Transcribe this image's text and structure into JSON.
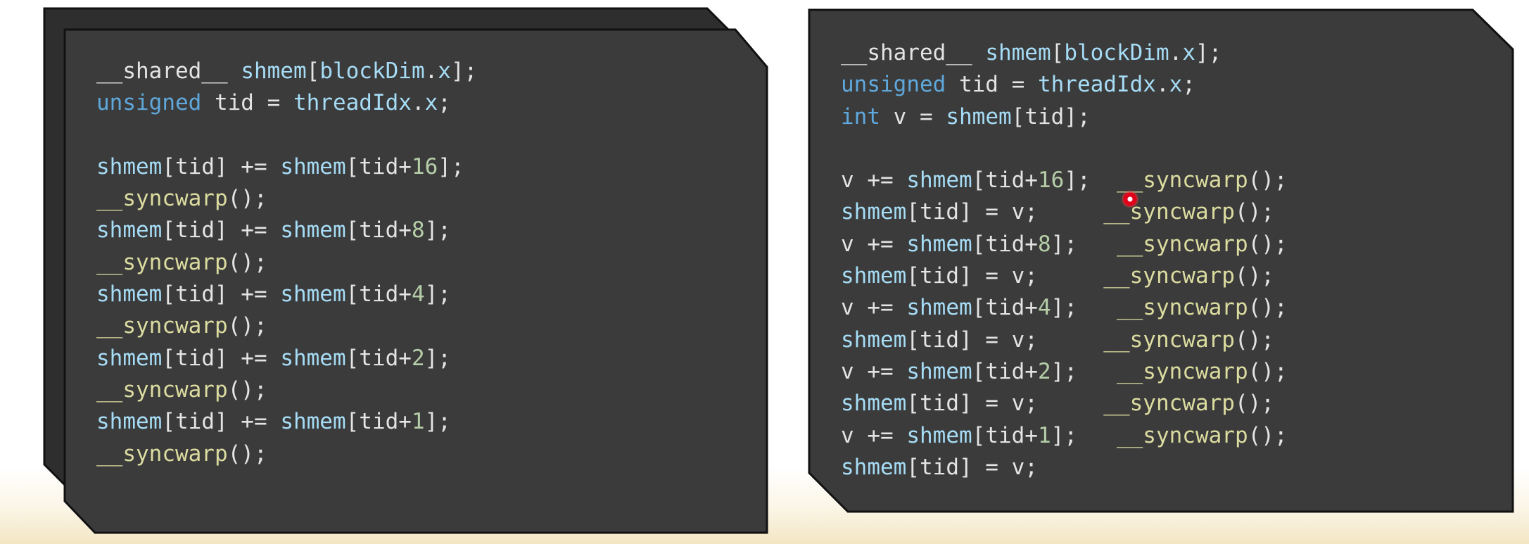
{
  "colors": {
    "panel_bg": "#3b3b3b",
    "keyword": "#5fa8dc",
    "identifier": "#a6dcf5",
    "function": "#dcdca0",
    "number": "#b5cea8",
    "plain": "#e4e4e4"
  },
  "left_panel": {
    "lines": [
      [
        {
          "t": "__shared__ ",
          "c": "pl"
        },
        {
          "t": "shmem",
          "c": "id"
        },
        {
          "t": "[",
          "c": "pl"
        },
        {
          "t": "blockDim",
          "c": "id"
        },
        {
          "t": ".",
          "c": "pl"
        },
        {
          "t": "x",
          "c": "id"
        },
        {
          "t": "];",
          "c": "pl"
        }
      ],
      [
        {
          "t": "unsigned",
          "c": "kw"
        },
        {
          "t": " tid = ",
          "c": "pl"
        },
        {
          "t": "threadIdx",
          "c": "id"
        },
        {
          "t": ".",
          "c": "pl"
        },
        {
          "t": "x",
          "c": "id"
        },
        {
          "t": ";",
          "c": "pl"
        }
      ],
      [],
      [
        {
          "t": "shmem",
          "c": "id"
        },
        {
          "t": "[tid] += ",
          "c": "pl"
        },
        {
          "t": "shmem",
          "c": "id"
        },
        {
          "t": "[tid+",
          "c": "pl"
        },
        {
          "t": "16",
          "c": "num"
        },
        {
          "t": "];",
          "c": "pl"
        }
      ],
      [
        {
          "t": "__syncwarp",
          "c": "fn"
        },
        {
          "t": "();",
          "c": "pl"
        }
      ],
      [
        {
          "t": "shmem",
          "c": "id"
        },
        {
          "t": "[tid] += ",
          "c": "pl"
        },
        {
          "t": "shmem",
          "c": "id"
        },
        {
          "t": "[tid+",
          "c": "pl"
        },
        {
          "t": "8",
          "c": "num"
        },
        {
          "t": "];",
          "c": "pl"
        }
      ],
      [
        {
          "t": "__syncwarp",
          "c": "fn"
        },
        {
          "t": "();",
          "c": "pl"
        }
      ],
      [
        {
          "t": "shmem",
          "c": "id"
        },
        {
          "t": "[tid] += ",
          "c": "pl"
        },
        {
          "t": "shmem",
          "c": "id"
        },
        {
          "t": "[tid+",
          "c": "pl"
        },
        {
          "t": "4",
          "c": "num"
        },
        {
          "t": "];",
          "c": "pl"
        }
      ],
      [
        {
          "t": "__syncwarp",
          "c": "fn"
        },
        {
          "t": "();",
          "c": "pl"
        }
      ],
      [
        {
          "t": "shmem",
          "c": "id"
        },
        {
          "t": "[tid] += ",
          "c": "pl"
        },
        {
          "t": "shmem",
          "c": "id"
        },
        {
          "t": "[tid+",
          "c": "pl"
        },
        {
          "t": "2",
          "c": "num"
        },
        {
          "t": "];",
          "c": "pl"
        }
      ],
      [
        {
          "t": "__syncwarp",
          "c": "fn"
        },
        {
          "t": "();",
          "c": "pl"
        }
      ],
      [
        {
          "t": "shmem",
          "c": "id"
        },
        {
          "t": "[tid] += ",
          "c": "pl"
        },
        {
          "t": "shmem",
          "c": "id"
        },
        {
          "t": "[tid+",
          "c": "pl"
        },
        {
          "t": "1",
          "c": "num"
        },
        {
          "t": "];",
          "c": "pl"
        }
      ],
      [
        {
          "t": "__syncwarp",
          "c": "fn"
        },
        {
          "t": "();",
          "c": "pl"
        }
      ]
    ]
  },
  "right_panel": {
    "lines": [
      [
        {
          "t": "__shared__ ",
          "c": "pl"
        },
        {
          "t": "shmem",
          "c": "id"
        },
        {
          "t": "[",
          "c": "pl"
        },
        {
          "t": "blockDim",
          "c": "id"
        },
        {
          "t": ".",
          "c": "pl"
        },
        {
          "t": "x",
          "c": "id"
        },
        {
          "t": "];",
          "c": "pl"
        }
      ],
      [
        {
          "t": "unsigned",
          "c": "kw"
        },
        {
          "t": " tid = ",
          "c": "pl"
        },
        {
          "t": "threadIdx",
          "c": "id"
        },
        {
          "t": ".",
          "c": "pl"
        },
        {
          "t": "x",
          "c": "id"
        },
        {
          "t": ";",
          "c": "pl"
        }
      ],
      [
        {
          "t": "int",
          "c": "kw"
        },
        {
          "t": " v = ",
          "c": "pl"
        },
        {
          "t": "shmem",
          "c": "id"
        },
        {
          "t": "[tid];",
          "c": "pl"
        }
      ],
      [],
      [
        {
          "t": "v += ",
          "c": "pl"
        },
        {
          "t": "shmem",
          "c": "id"
        },
        {
          "t": "[tid+",
          "c": "pl"
        },
        {
          "t": "16",
          "c": "num"
        },
        {
          "t": "];  ",
          "c": "pl"
        },
        {
          "t": "__syncwarp",
          "c": "fn"
        },
        {
          "t": "();",
          "c": "pl"
        }
      ],
      [
        {
          "t": "shmem",
          "c": "id"
        },
        {
          "t": "[tid] = v;     ",
          "c": "pl"
        },
        {
          "t": "__syncwarp",
          "c": "fn"
        },
        {
          "t": "();",
          "c": "pl"
        }
      ],
      [
        {
          "t": "v += ",
          "c": "pl"
        },
        {
          "t": "shmem",
          "c": "id"
        },
        {
          "t": "[tid+",
          "c": "pl"
        },
        {
          "t": "8",
          "c": "num"
        },
        {
          "t": "];   ",
          "c": "pl"
        },
        {
          "t": "__syncwarp",
          "c": "fn"
        },
        {
          "t": "();",
          "c": "pl"
        }
      ],
      [
        {
          "t": "shmem",
          "c": "id"
        },
        {
          "t": "[tid] = v;     ",
          "c": "pl"
        },
        {
          "t": "__syncwarp",
          "c": "fn"
        },
        {
          "t": "();",
          "c": "pl"
        }
      ],
      [
        {
          "t": "v += ",
          "c": "pl"
        },
        {
          "t": "shmem",
          "c": "id"
        },
        {
          "t": "[tid+",
          "c": "pl"
        },
        {
          "t": "4",
          "c": "num"
        },
        {
          "t": "];   ",
          "c": "pl"
        },
        {
          "t": "__syncwarp",
          "c": "fn"
        },
        {
          "t": "();",
          "c": "pl"
        }
      ],
      [
        {
          "t": "shmem",
          "c": "id"
        },
        {
          "t": "[tid] = v;     ",
          "c": "pl"
        },
        {
          "t": "__syncwarp",
          "c": "fn"
        },
        {
          "t": "();",
          "c": "pl"
        }
      ],
      [
        {
          "t": "v += ",
          "c": "pl"
        },
        {
          "t": "shmem",
          "c": "id"
        },
        {
          "t": "[tid+",
          "c": "pl"
        },
        {
          "t": "2",
          "c": "num"
        },
        {
          "t": "];   ",
          "c": "pl"
        },
        {
          "t": "__syncwarp",
          "c": "fn"
        },
        {
          "t": "();",
          "c": "pl"
        }
      ],
      [
        {
          "t": "shmem",
          "c": "id"
        },
        {
          "t": "[tid] = v;     ",
          "c": "pl"
        },
        {
          "t": "__syncwarp",
          "c": "fn"
        },
        {
          "t": "();",
          "c": "pl"
        }
      ],
      [
        {
          "t": "v += ",
          "c": "pl"
        },
        {
          "t": "shmem",
          "c": "id"
        },
        {
          "t": "[tid+",
          "c": "pl"
        },
        {
          "t": "1",
          "c": "num"
        },
        {
          "t": "];   ",
          "c": "pl"
        },
        {
          "t": "__syncwarp",
          "c": "fn"
        },
        {
          "t": "();",
          "c": "pl"
        }
      ],
      [
        {
          "t": "shmem",
          "c": "id"
        },
        {
          "t": "[tid] = v;",
          "c": "pl"
        }
      ]
    ]
  }
}
